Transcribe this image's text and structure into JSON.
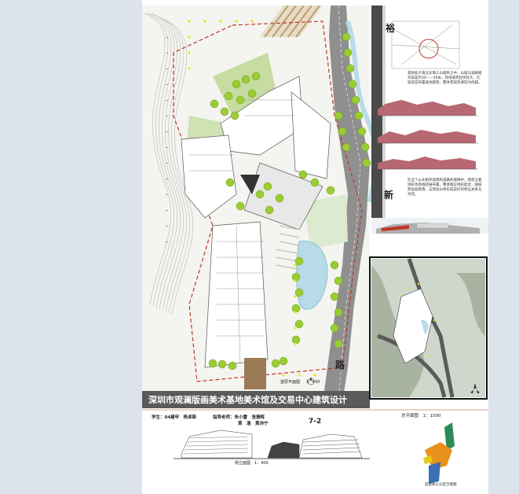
{
  "board": {
    "title": "深圳市观澜版画美术基地美术馆及交易中心建筑设计",
    "plan_label": "首层平面图",
    "plan_scale": "1：400",
    "road_char_1": "裕",
    "road_char_2": "新",
    "road_char_3": "路",
    "student": "学生：04建甲　杨卓斯",
    "advisors": "指导老师：朱小雷　张振辉",
    "advisors_2": "黄　渝　黄沛宁",
    "sheet_number": "7-2",
    "site_plan_label": "总平面图　1：1500",
    "elevation_label": "侧立面图　1：400",
    "diagram_label": "首层防火分区示意图",
    "note_1": "基地处于观北东南三山相夹之中，山坡与道路相对高差约30——40米，场地坡势起伏较大，比较适宜布置坡地建筑，整体景观资源较为优越。",
    "note_2": "在这个山水相夹成景和道路的缝隙中，建筑沿着地形等高线舒展布置，整体顺应地形起伏，随坡势层层跌落，与周边山体形成良好的呼应关系与对话。"
  },
  "colors": {
    "accent_red": "#c0392b",
    "title_bg": "#5a5a5a",
    "tree_green": "#9acd32",
    "water_blue": "#b8dbe8",
    "road_dark": "#4a4a4a"
  }
}
